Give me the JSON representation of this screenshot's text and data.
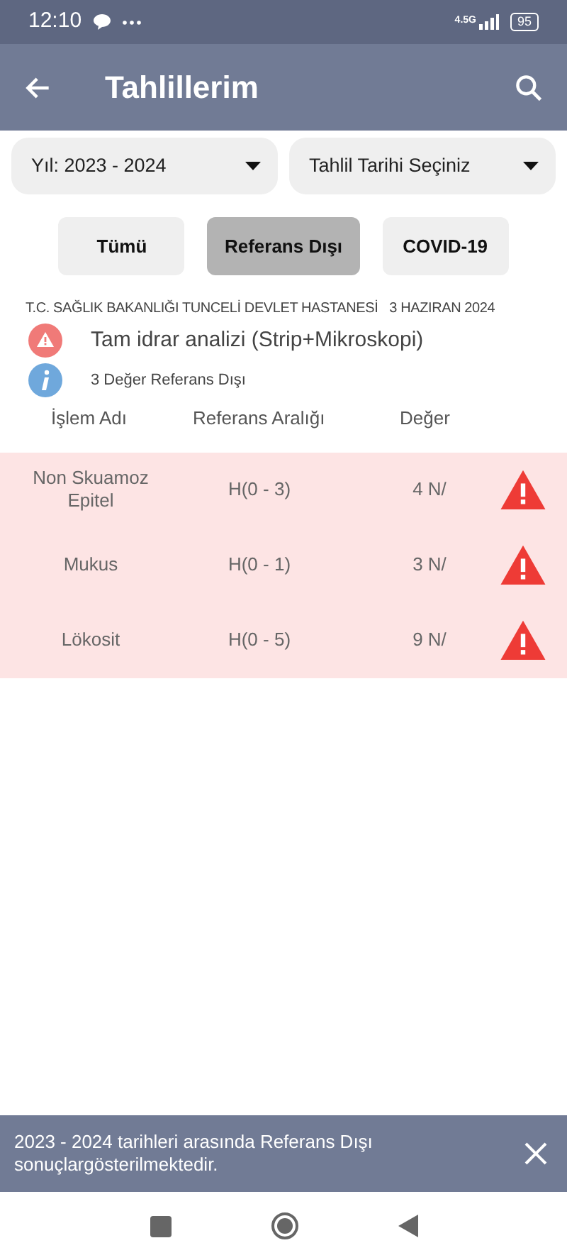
{
  "status_bar": {
    "time": "12:10",
    "network": "4.5G",
    "battery": "95"
  },
  "app_bar": {
    "title": "Tahlillerim"
  },
  "filters": [
    {
      "label": "Yıl: 2023 - 2024"
    },
    {
      "label": "Tahlil Tarihi Seçiniz"
    }
  ],
  "chips": [
    {
      "label": "Tümü",
      "selected": false
    },
    {
      "label": "Referans Dışı",
      "selected": true
    },
    {
      "label": "COVID-19",
      "selected": false
    }
  ],
  "result": {
    "hospital": "T.C. SAĞLIK BAKANLIĞI TUNCELİ DEVLET HASTANESİ",
    "date": "3 HAZIRAN 2024",
    "test_name": "Tam idrar analizi (Strip+Mikroskopi)",
    "summary": "3 Değer Referans Dışı"
  },
  "table": {
    "columns": [
      "İşlem Adı",
      "Referans Aralığı",
      "Değer"
    ],
    "rows": [
      {
        "name": "Non Skuamoz Epitel",
        "range": "H(0 - 3)",
        "value": "4 N/",
        "out_of_range": true
      },
      {
        "name": "Mukus",
        "range": "H(0 - 1)",
        "value": "3 N/",
        "out_of_range": true
      },
      {
        "name": "Lökosit",
        "range": "H(0 - 5)",
        "value": "9 N/",
        "out_of_range": true
      }
    ]
  },
  "snackbar": {
    "message": "2023 - 2024 tarihleri arasında Referans Dışı sonuçlargösterilmektedir."
  }
}
